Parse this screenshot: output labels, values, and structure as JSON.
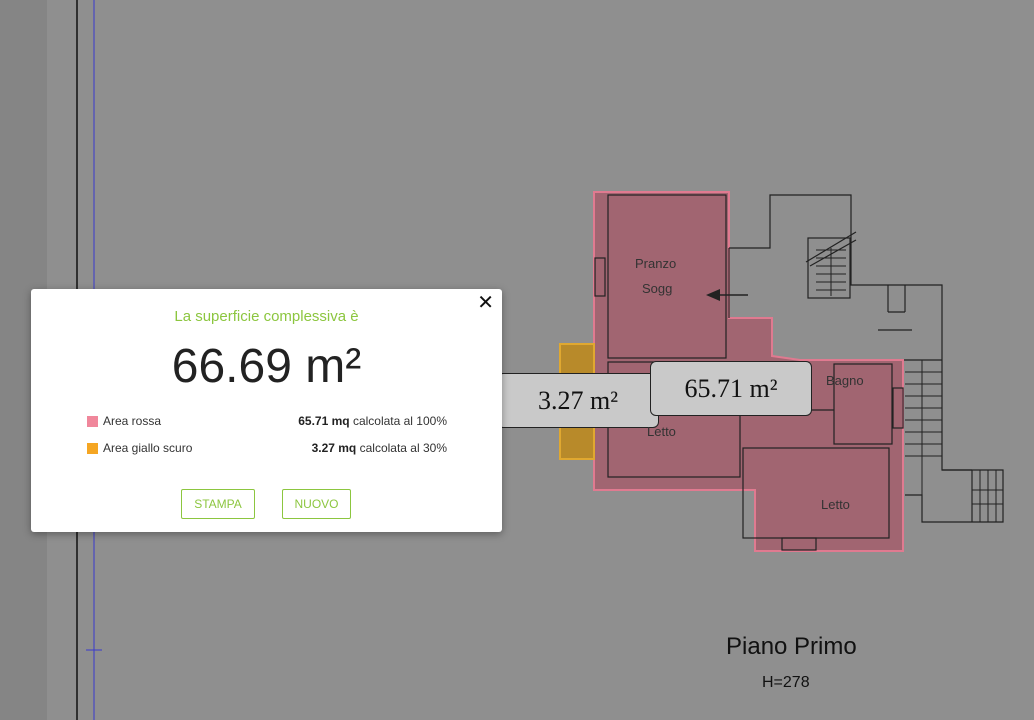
{
  "plan": {
    "tag_yellow": "3.27 m²",
    "tag_red": "65.71 m²",
    "rooms": {
      "pranzo": "Pranzo",
      "sogg": "Sogg",
      "bagno": "Bagno",
      "letto1": "Letto",
      "letto2": "Letto"
    },
    "floor_title": "Piano Primo",
    "floor_height": "H=278"
  },
  "dialog": {
    "subtitle": "La superficie complessiva è",
    "total": "66.69 m²",
    "rows": [
      {
        "label": "Area rossa",
        "value": "65.71 mq",
        "note": "calcolata al 100%",
        "color": "#f0879b"
      },
      {
        "label": "Area giallo scuro",
        "value": "3.27 mq",
        "note": "calcolata al 30%",
        "color": "#f5a623"
      }
    ],
    "buttons": {
      "print": "STAMPA",
      "new": "NUOVO"
    },
    "close_icon": "close-icon"
  },
  "colors": {
    "accent": "#8cc63f",
    "red_area": "#a05a6a",
    "yellow_area": "#b88a2a"
  }
}
